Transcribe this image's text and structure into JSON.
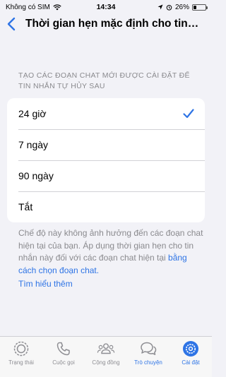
{
  "status_bar": {
    "carrier": "Không có SIM",
    "time": "14:34",
    "battery": "26%",
    "battery_level": 0.26
  },
  "nav": {
    "title": "Thời gian hẹn mặc định cho tin n..."
  },
  "section_header": "TẠO CÁC ĐOẠN CHAT MỚI ĐƯỢC CÀI ĐẶT ĐỂ TIN NHẮN TỰ HỦY SAU",
  "options": [
    {
      "label": "24 giờ",
      "selected": true
    },
    {
      "label": "7 ngày",
      "selected": false
    },
    {
      "label": "90 ngày",
      "selected": false
    },
    {
      "label": "Tắt",
      "selected": false
    }
  ],
  "footer": {
    "text": "Chế độ này không ảnh hưởng đến các đoạn chat hiện tại của bạn. Áp dụng thời gian hẹn cho tin nhắn này đối với các đoạn chat hiện tại ",
    "link": "bằng cách chọn đoạn chat.",
    "learn_more": "Tìm hiểu thêm"
  },
  "tabs": [
    {
      "label": "Trạng thái",
      "icon": "status-icon"
    },
    {
      "label": "Cuộc gọi",
      "icon": "phone-icon"
    },
    {
      "label": "Cộng đồng",
      "icon": "community-icon"
    },
    {
      "label": "Trò chuyện",
      "icon": "chats-icon"
    },
    {
      "label": "Cài đặt",
      "icon": "settings-icon"
    }
  ],
  "colors": {
    "accent": "#2e74e5",
    "background": "#f2f2f7"
  }
}
